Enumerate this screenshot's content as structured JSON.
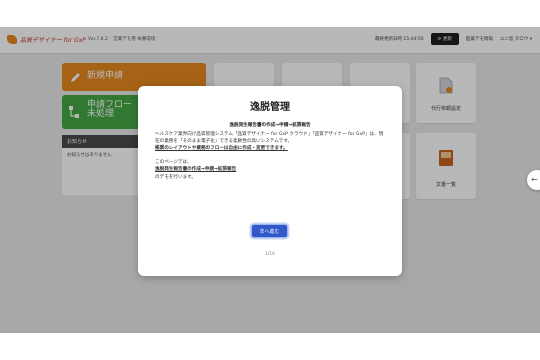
{
  "header": {
    "logo_text": "品質デザイナー for GxP",
    "version": "Ver.7.8.2",
    "env": "営業デモ用 本番環境",
    "last_update": "最終更新日時 15:44:50",
    "refresh_label": "更新",
    "company": "医薬デモ情報",
    "user": "ユニ島 タロウ"
  },
  "tiles": {
    "new_request": "新規申請",
    "flow_line1": "申請フロー",
    "flow_line2": "未処理",
    "notice_title": "お知らせ",
    "notice_body": "お知らせはありません",
    "proxy_request": "代行依頼設定",
    "doc_list": "文書一覧"
  },
  "modal": {
    "title": "逸脱管理",
    "subtitle": "逸脱発生報告書の作成→申請→拡張報告",
    "para1": "ヘルスケア業界向け品質管理システム「品質デザイナー for GxP クラウド」「品質デザイナー for GxP」は、現在の業務を「そのまま電子化」できる柔軟性の高いシステムです。",
    "para1_emph": "帳票のレイアウトや業務のフローは自由に作成・変更できます。",
    "para2": "このページでは、",
    "para2_emph": "逸脱発生報告書の作成→申請→拡張報告",
    "para3": "のデモを行います。",
    "next_button": "次へ進む",
    "pager": "1/16"
  },
  "colors": {
    "orange": "#e8891e",
    "green": "#45a845",
    "primary_button": "#2f59c7"
  }
}
